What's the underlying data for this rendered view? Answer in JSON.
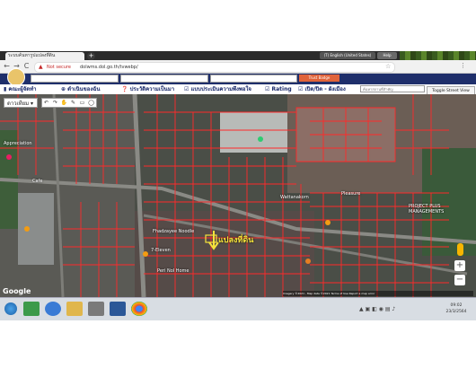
{
  "browser": {
    "tab_title": "ระบบค้นหารูปแปลงที่ดิน",
    "new_tab": "+",
    "language_pill": "(T) English (United States)",
    "help_pill": "Help",
    "security_label": "Not secure",
    "url": "dolwms.dol.go.th/tvwebp/",
    "back": "←",
    "forward": "→",
    "reload": "C",
    "star": "☆",
    "menu": "⋮"
  },
  "site": {
    "orange_button": "Trust Badge",
    "menu": [
      "คณะผู้จัดทำ",
      "ดำเนินของฉัน",
      "ประวัติความเป็นมา",
      "แบบประเมินความพึงพอใจ",
      "Rating",
      "เปิด/ปิด - ผังเมือง"
    ],
    "search_placeholder": "ค้นหาสถานที่สำคัญ",
    "street_view_button": "Toggle Street View"
  },
  "map": {
    "map_type": "ดาวเทียม",
    "tools": [
      "↶",
      "↷",
      "✋",
      "✎",
      "▭",
      "◯"
    ],
    "plot_label": "แปลงที่ดิน",
    "labels": [
      {
        "text": "Appreciation"
      },
      {
        "text": "Cafe"
      },
      {
        "text": "7-Eleven"
      },
      {
        "text": "Fhadzayee Noodle"
      },
      {
        "text": "Peri Nol Home"
      },
      {
        "text": "PROJECT PLUS MANAGEMENTS"
      },
      {
        "text": "Pleasure"
      },
      {
        "text": "Wattanakorn"
      }
    ],
    "google_logo": "Google",
    "attribution": "Imagery ©2021 , Map data ©2021 Terms of Use  Report a map error",
    "zoom_in": "+",
    "zoom_out": "−"
  },
  "taskbar": {
    "clock_time": "09:02",
    "clock_date": "23/3/2564"
  },
  "colors": {
    "parcel_line": "#ff2a2a",
    "header_bg": "#1f2f6b",
    "plot_label": "#f5e33b"
  }
}
